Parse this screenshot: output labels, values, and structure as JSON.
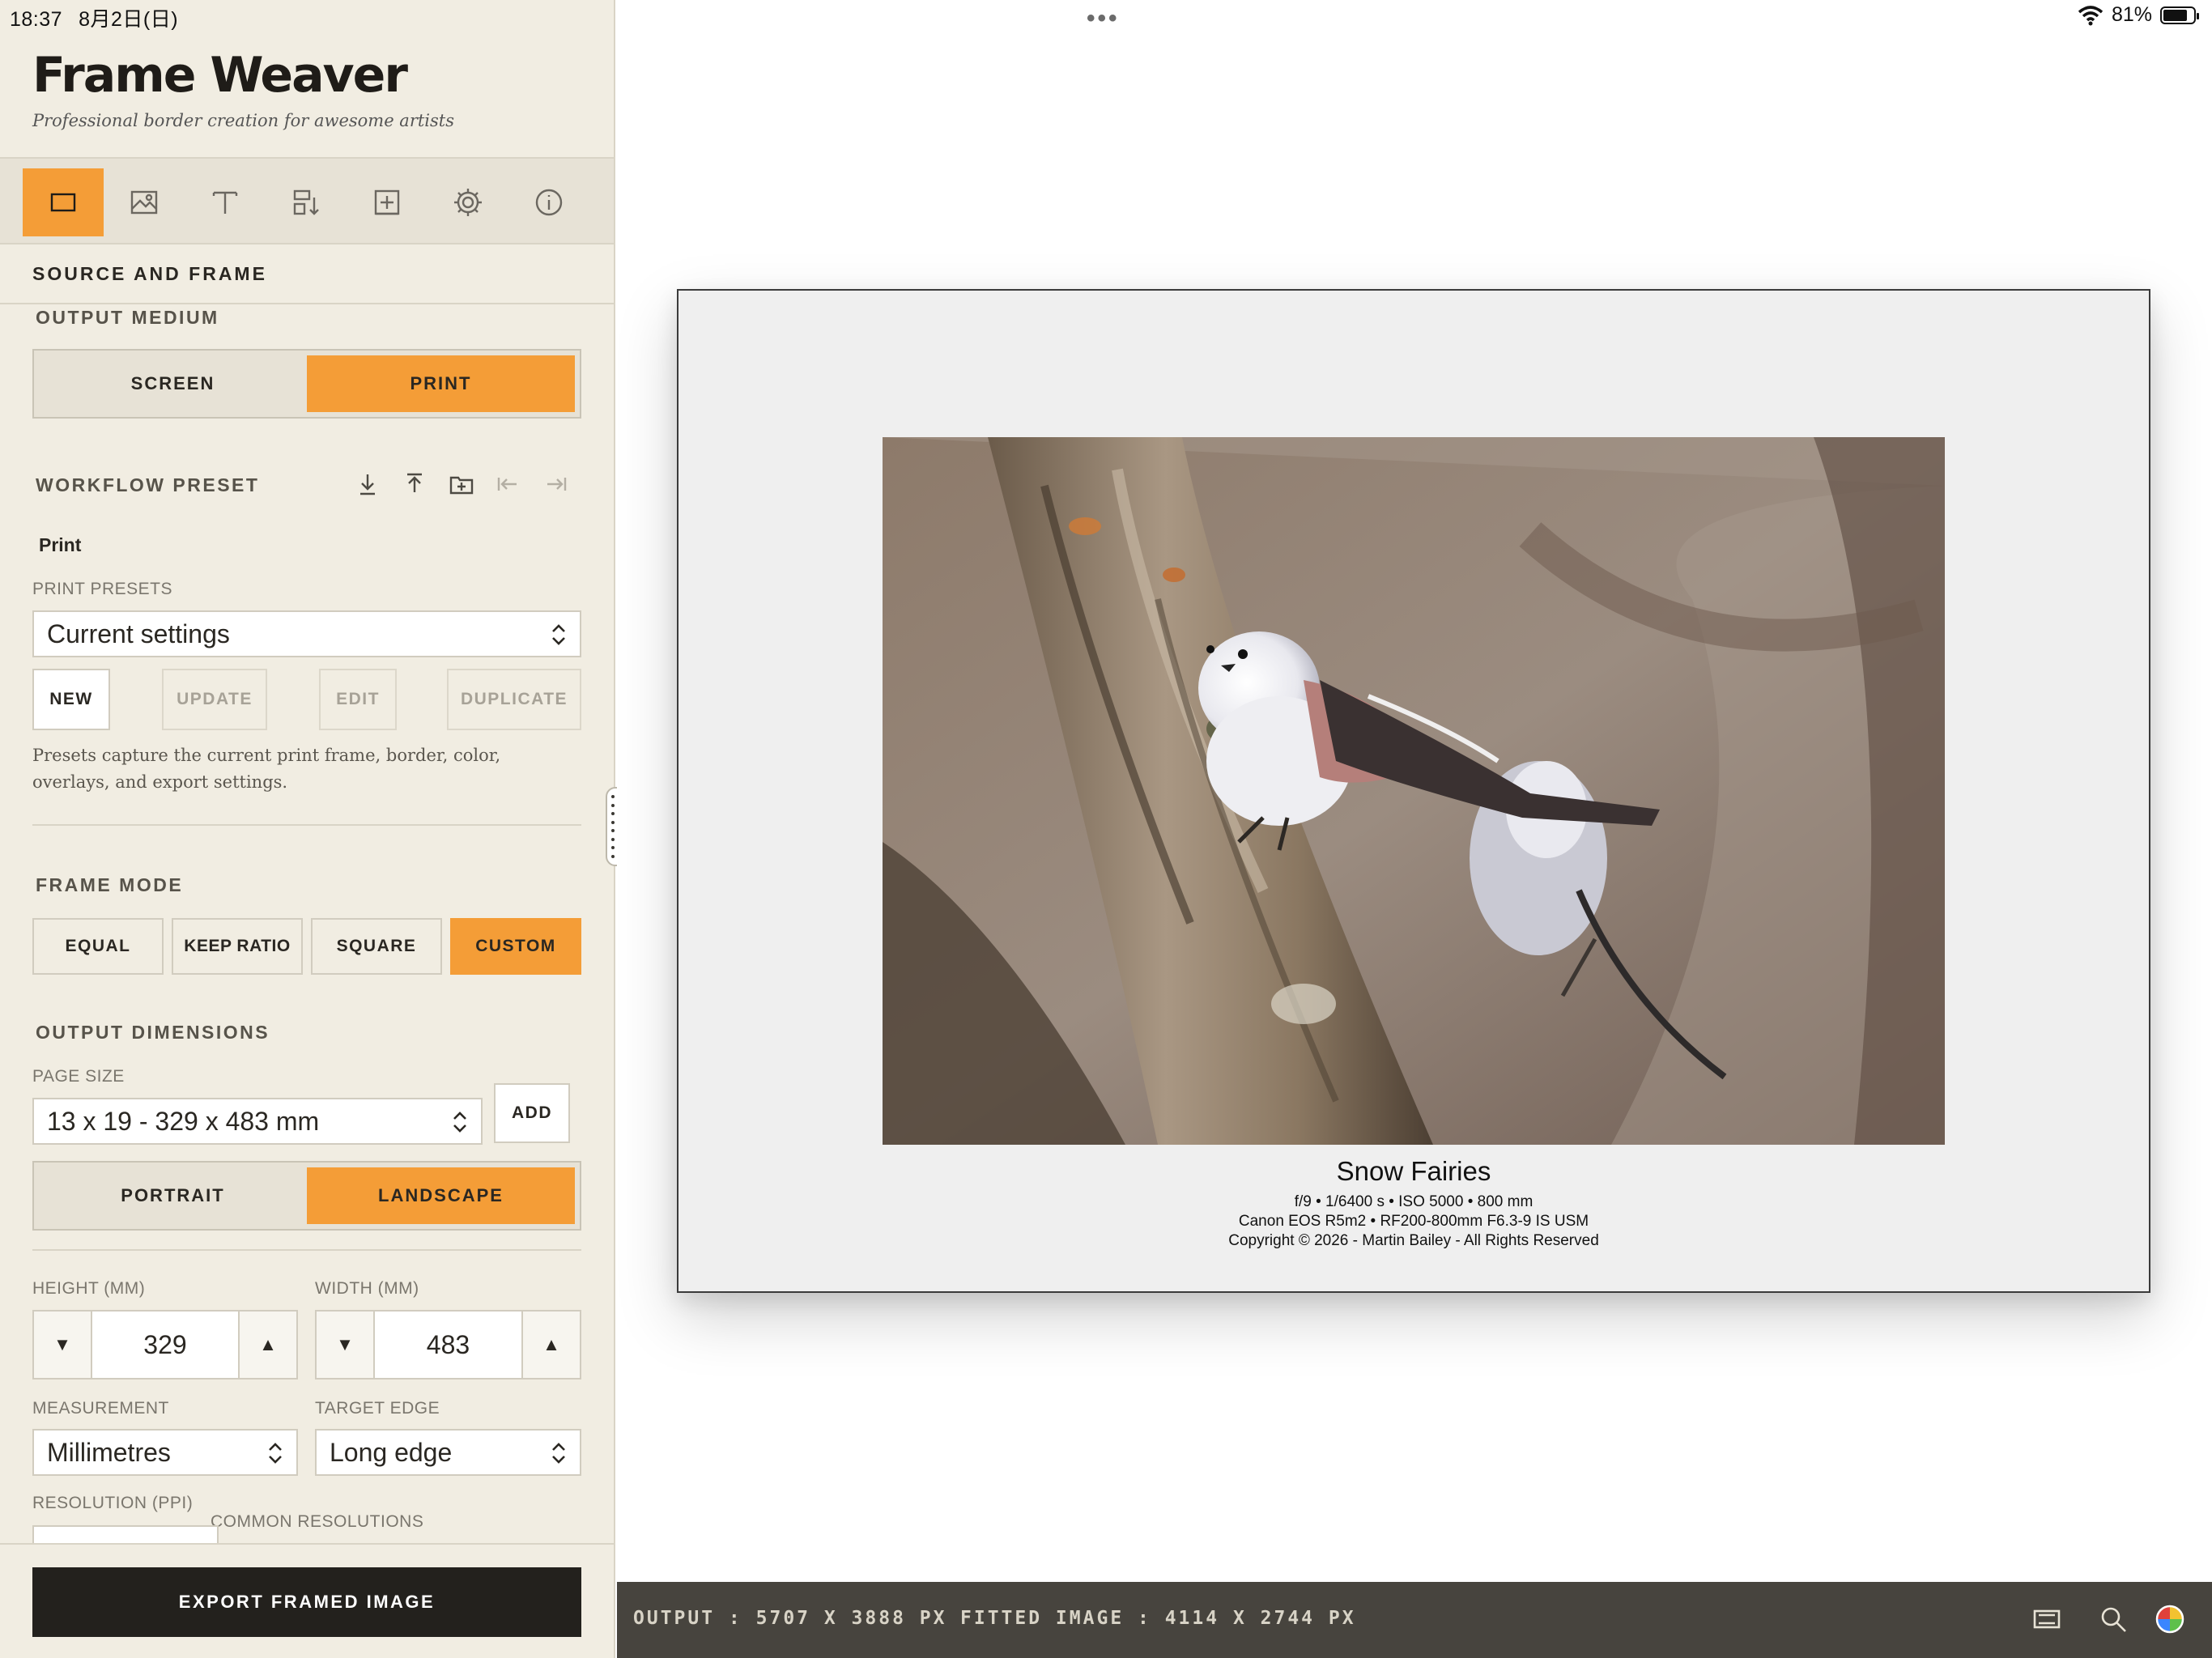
{
  "status_bar": {
    "time": "18:37",
    "date": "8月2日(日)",
    "dots": "•••",
    "battery_percent": "81%",
    "battery_level": 0.81
  },
  "app": {
    "title": "Frame Weaver",
    "subtitle": "Professional border creation for awesome artists"
  },
  "toolbar": {
    "tabs": [
      "frame-icon",
      "image-icon",
      "text-icon",
      "align-icon",
      "add-icon",
      "settings-icon",
      "info-icon"
    ],
    "active_index": 0
  },
  "section": {
    "title": "SOURCE AND FRAME"
  },
  "output_medium": {
    "label": "OUTPUT MEDIUM",
    "options": [
      "SCREEN",
      "PRINT"
    ],
    "selected": "PRINT"
  },
  "workflow_preset": {
    "label": "WORKFLOW PRESET",
    "current": "Print"
  },
  "print_presets": {
    "label": "PRINT PRESETS",
    "selected": "Current settings",
    "buttons": {
      "new": "NEW",
      "update": "UPDATE",
      "edit": "EDIT",
      "duplicate": "DUPLICATE"
    },
    "help": "Presets capture the current print frame, border, color, overlays, and export settings."
  },
  "frame_mode": {
    "label": "FRAME MODE",
    "options": [
      "EQUAL",
      "KEEP RATIO",
      "SQUARE",
      "CUSTOM"
    ],
    "selected": "CUSTOM"
  },
  "output_dimensions": {
    "label": "OUTPUT DIMENSIONS",
    "page_size_label": "PAGE SIZE",
    "page_size": "13 x 19 - 329 x 483 mm",
    "add_label": "ADD",
    "orientation": [
      "PORTRAIT",
      "LANDSCAPE"
    ],
    "orientation_selected": "LANDSCAPE",
    "height_label": "HEIGHT (MM)",
    "height": "329",
    "width_label": "WIDTH (MM)",
    "width": "483",
    "down_arrow": "▼",
    "up_arrow": "▲",
    "measurement_label": "MEASUREMENT",
    "measurement": "Millimetres",
    "target_edge_label": "TARGET EDGE",
    "target_edge": "Long edge",
    "resolution_label": "RESOLUTION (PPI)",
    "common_resolutions_label": "COMMON RESOLUTIONS"
  },
  "export": {
    "label": "EXPORT FRAMED IMAGE"
  },
  "caption": {
    "title": "Snow Fairies",
    "exposure": "f/9 • 1/6400 s • ISO 5000 • 800 mm",
    "gear": "Canon EOS R5m2 • RF200-800mm F6.3-9 IS USM",
    "copyright": "Copyright © 2026 - Martin Bailey - All Rights Reserved"
  },
  "bottom_bar": {
    "output": "OUTPUT : 5707 X 3888 PX",
    "fitted": "FITTED IMAGE : 4114 X 2744 PX",
    "icons": [
      "screen-icon",
      "zoom-icon",
      "color-wheel-icon"
    ]
  },
  "colors": {
    "accent": "#f49d37",
    "sidebar_bg": "#f1ede2",
    "dark": "#23211d",
    "status_bar_bg": "#47443e"
  }
}
